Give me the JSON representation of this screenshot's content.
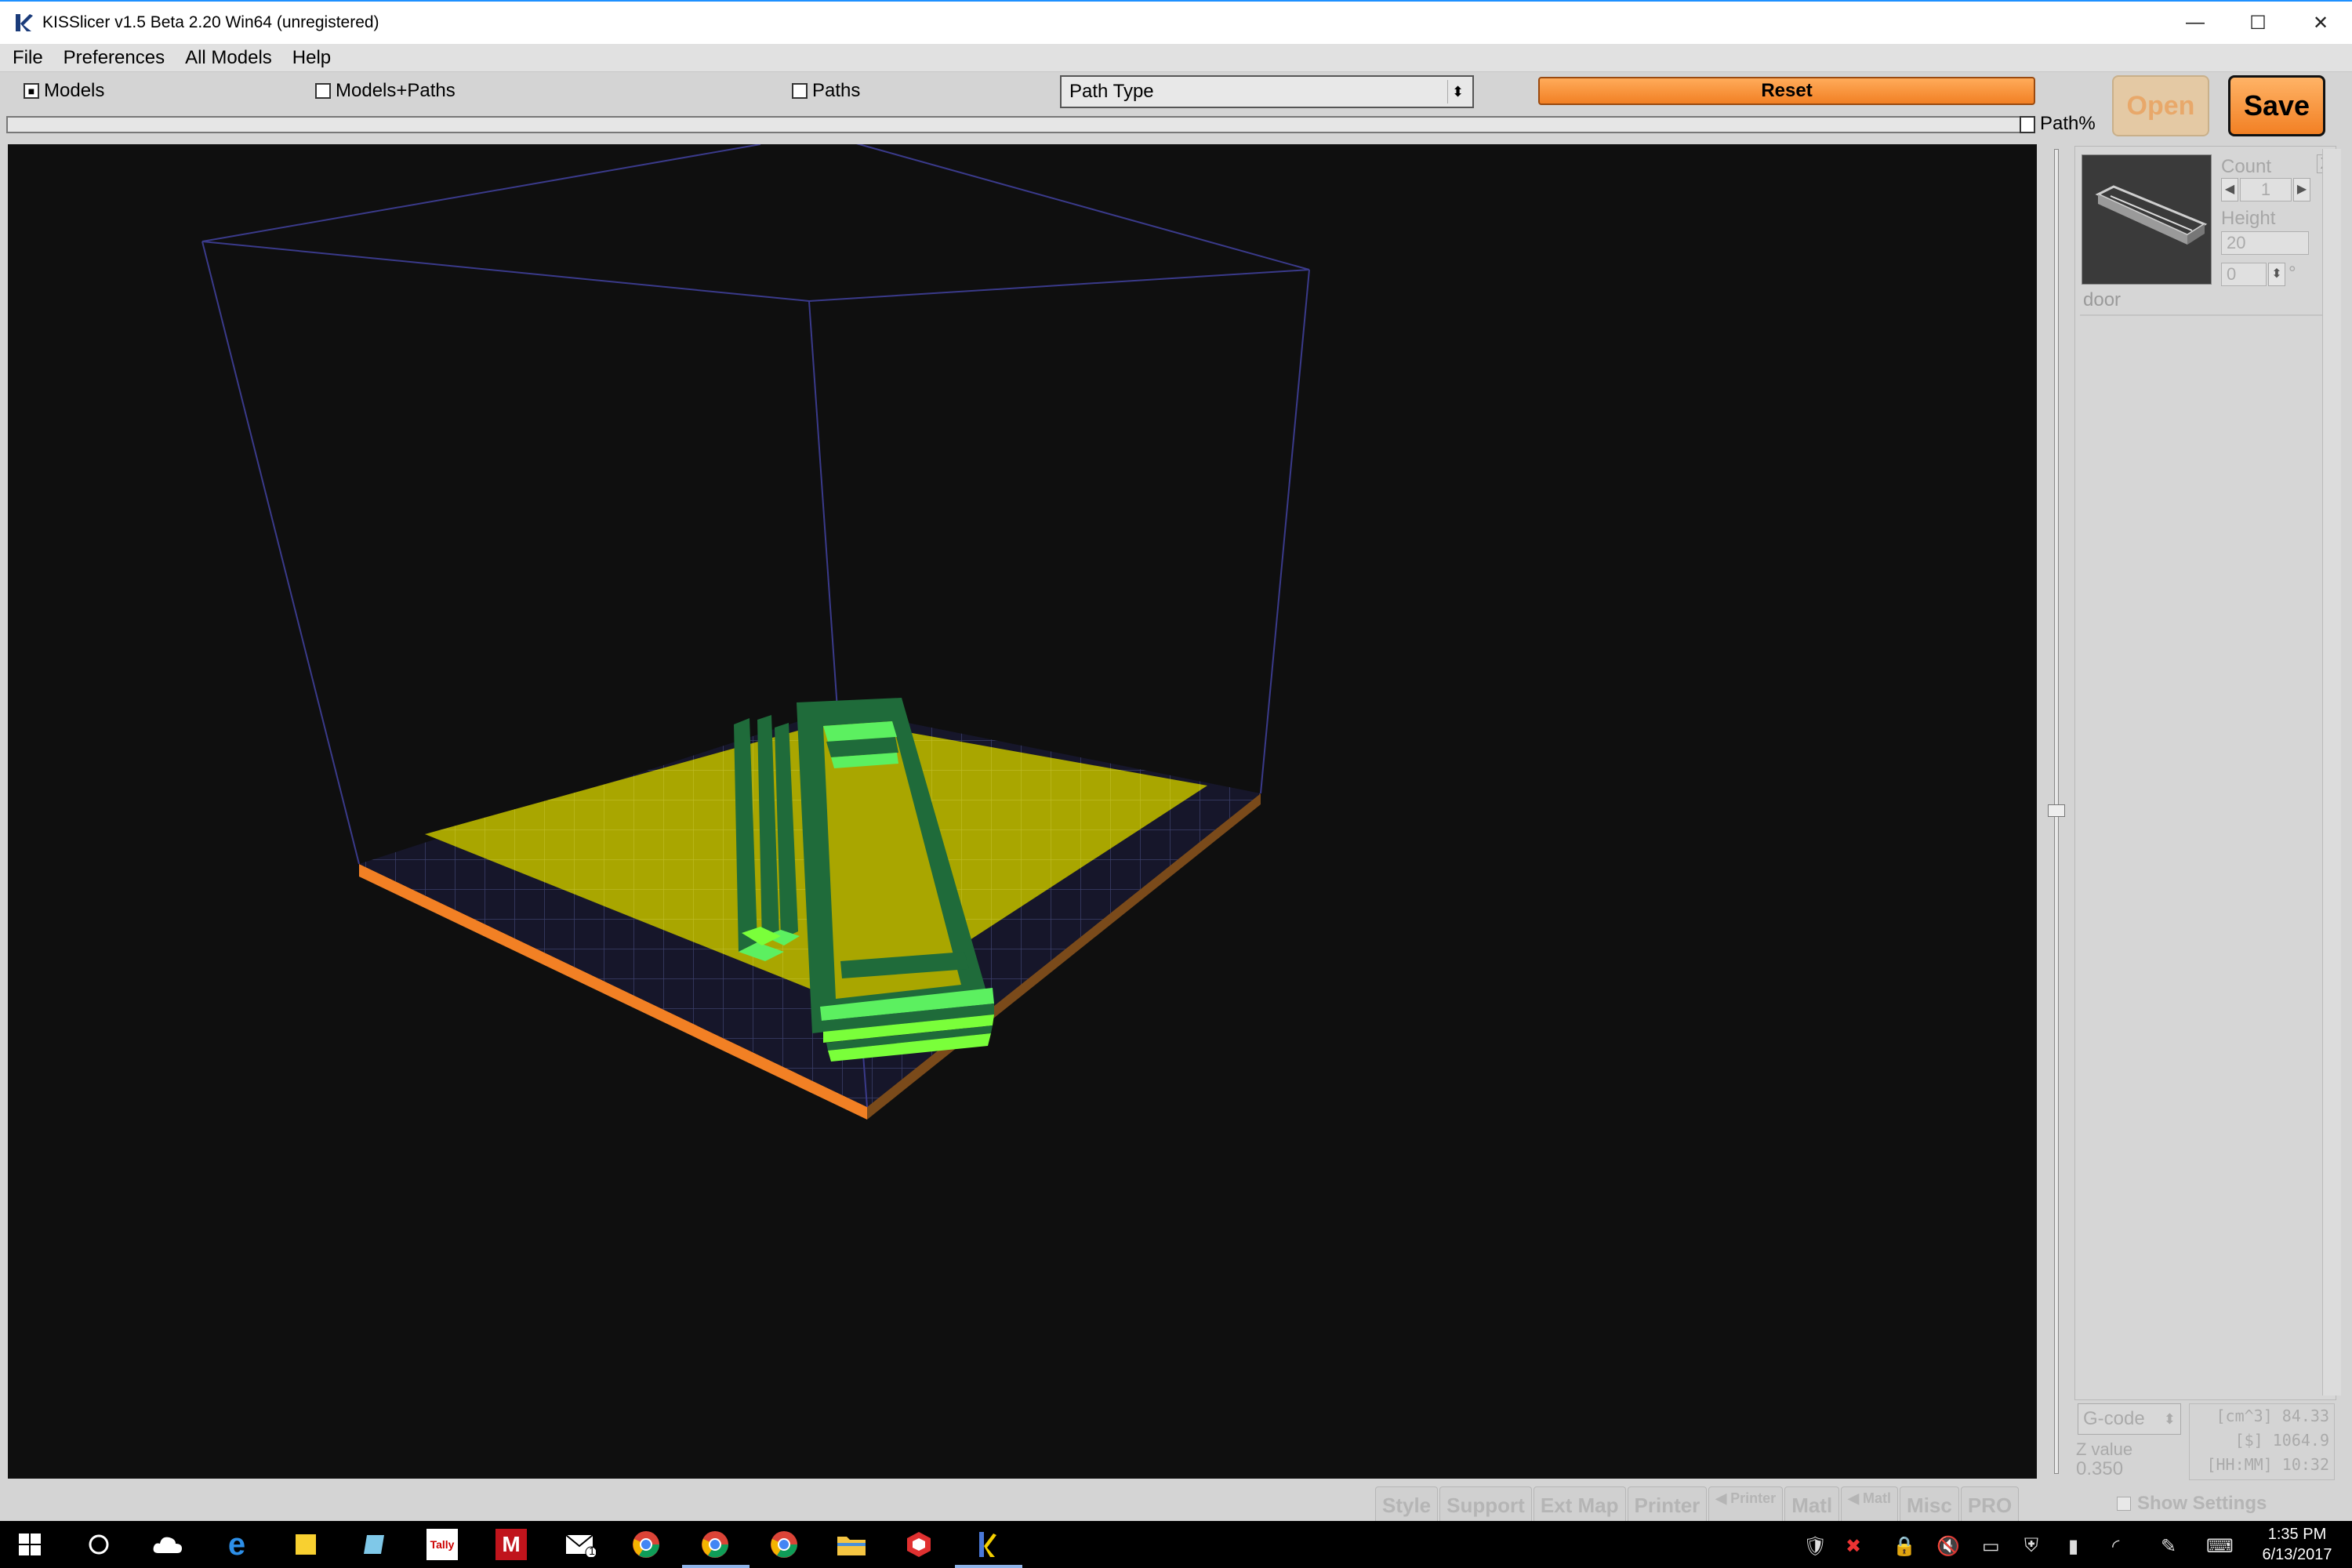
{
  "window": {
    "title": "KISSlicer v1.5 Beta 2.20 Win64 (unregistered)",
    "minimize_glyph": "—",
    "maximize_glyph": "☐",
    "close_glyph": "✕"
  },
  "menu": {
    "items": [
      "File",
      "Preferences",
      "All Models",
      "Help"
    ]
  },
  "toolbar": {
    "view_models": "Models",
    "view_models_paths": "Models+Paths",
    "view_paths": "Paths",
    "path_type": "Path Type",
    "reset": "Reset",
    "path_pct": "Path%",
    "open": "Open",
    "save": "Save",
    "checked_mark": "■"
  },
  "model_panel": {
    "name": "door",
    "count_label": "Count",
    "count_value": "1",
    "height_label": "Height",
    "height_value": "20",
    "rotation_value": "0",
    "degree": "°",
    "remove": "X"
  },
  "output": {
    "format": "G-code",
    "z_label": "Z value",
    "z_value": "0.350",
    "volume": "[cm^3] 84.33",
    "cost": "[$] 1064.9",
    "time": "[HH:MM] 10:32"
  },
  "tabs": [
    "Style",
    "Support",
    "Ext Map",
    "Printer",
    "Printer",
    "Matl",
    "Matl",
    "Misc",
    "PRO"
  ],
  "show_settings": "Show Settings",
  "colors": {
    "accent_orange": "#f28024",
    "viewport_bg": "#0f0f0f",
    "bed_yellow": "#a9a600",
    "model_green": "#1f6b3a",
    "model_light_green": "#5cf060"
  },
  "taskbar": {
    "pinned_icons": [
      "windows-icon",
      "cortana-icon",
      "onedrive-icon",
      "edge-icon",
      "sticky-notes-icon",
      "notepad-icon",
      "tally-icon",
      "m-app-icon",
      "mail-icon",
      "chrome-icon",
      "chrome-icon",
      "chrome-icon",
      "file-explorer-icon",
      "sketchup-icon",
      "kisslicer-icon"
    ],
    "tally_label": "Tally",
    "m_label": "M",
    "mail_badge": "1",
    "time": "1:35 PM",
    "date": "6/13/2017"
  }
}
